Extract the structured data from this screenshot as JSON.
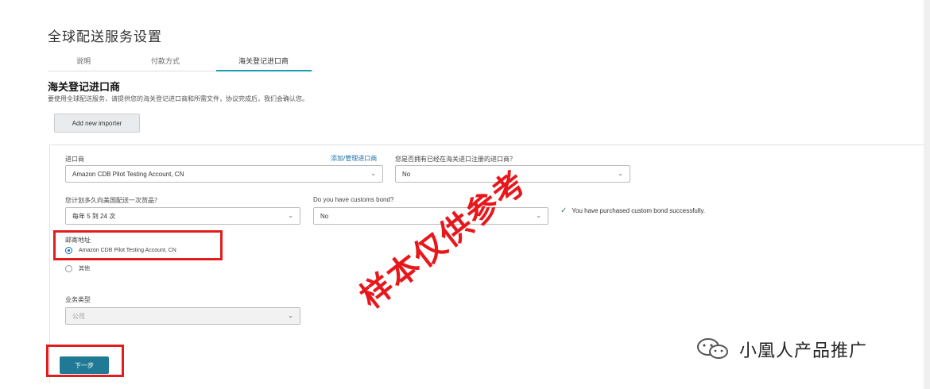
{
  "page_title": "全球配送服务设置",
  "tabs": [
    {
      "label": "说明"
    },
    {
      "label": "付款方式"
    },
    {
      "label": "海关登记进口商"
    }
  ],
  "section": {
    "title": "海关登记进口商",
    "description": "要使用全球配送服务，请提供您的海关登记进口商和所需文件，协议完成后，我们会确认您。"
  },
  "add_importer_label": "Add new importer",
  "form": {
    "importer_label": "进口商",
    "importer_link": "添加/管理进口商",
    "importer_value": "Amazon CDB Pilot Testing Account, CN",
    "has_record_label": "您是否拥有已经在海关进口注册的进口商？",
    "has_record_value": "No",
    "frequency_label": "您计划多久向美国配送一次货品？",
    "frequency_value": "每年 5 到 24 次",
    "bond_label": "Do you have customs bond?",
    "bond_value": "No",
    "success_text": "You have purchased custom bond successfully.",
    "mailing_label": "邮寄地址",
    "mailing_option1": "Amazon CDB Pilot Testing Account, CN",
    "mailing_option2": "其他",
    "business_type_label": "业务类型",
    "business_type_value": "公司"
  },
  "next_label": "下一步",
  "watermark": "样本仅供参考",
  "wechat_account": "小凰人产品推广",
  "colors": {
    "accent": "#1a9bb8",
    "primary_button": "#207a96",
    "highlight": "#e01e1e",
    "link": "#1b6ea8"
  }
}
